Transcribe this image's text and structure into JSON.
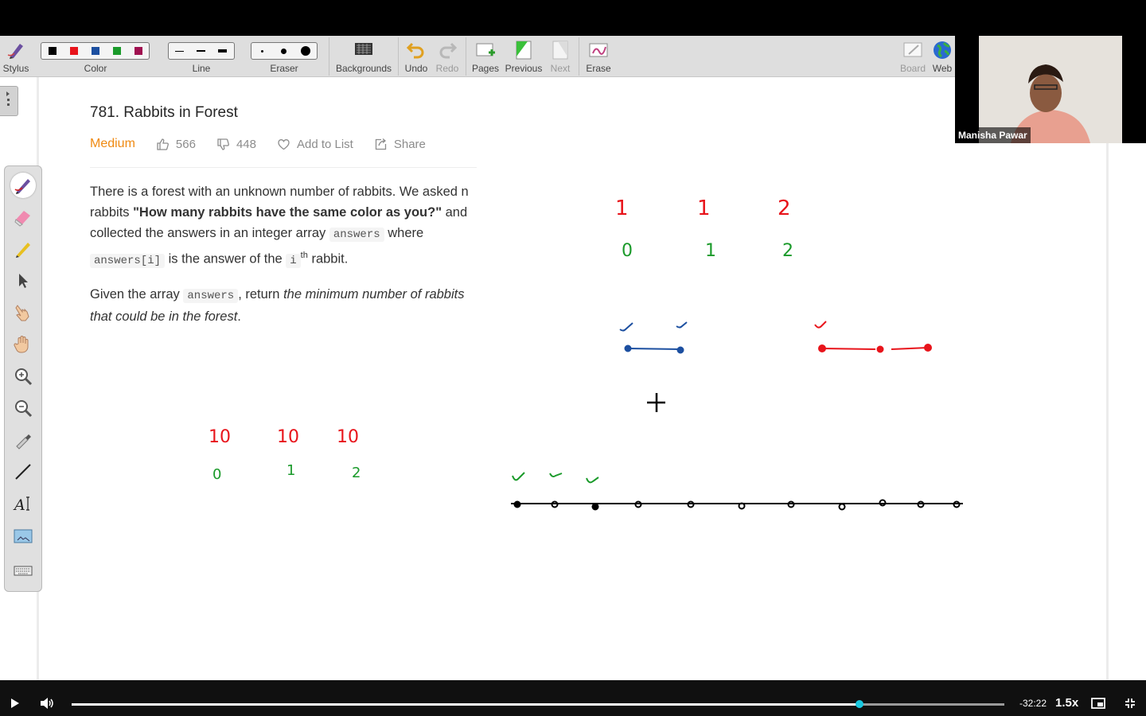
{
  "toolbar": {
    "stylus": "Stylus",
    "color": "Color",
    "line": "Line",
    "eraser": "Eraser",
    "backgrounds": "Backgrounds",
    "undo": "Undo",
    "redo": "Redo",
    "pages": "Pages",
    "previous": "Previous",
    "next": "Next",
    "erase": "Erase",
    "board": "Board",
    "web": "Web",
    "colors": [
      "#000000",
      "#e8141b",
      "#1c4fa0",
      "#1a9a2a",
      "#a01050"
    ]
  },
  "problem": {
    "title": "781. Rabbits in Forest",
    "difficulty": "Medium",
    "likes": "566",
    "dislikes": "448",
    "add_to_list": "Add to List",
    "share": "Share",
    "p1": {
      "t1": "There is a forest with an unknown number of rabbits. We asked n rabbits ",
      "bold": "\"How many rabbits have the same color as you?\"",
      "t2": " and collected the answers in an integer array ",
      "code1": "answers",
      "t3": " where ",
      "code2": "answers[i]",
      "t4": " is the answer of the ",
      "code3": "i",
      "sup": "th",
      "t5": " rabbit."
    },
    "p2": {
      "t1": "Given the array ",
      "code1": "answers",
      "t2": ", return ",
      "em": "the minimum number of rabbits that could be in the forest",
      "t3": "."
    }
  },
  "drawing": {
    "top_values": [
      "1",
      "1",
      "2"
    ],
    "top_indices": [
      "0",
      "1",
      "2"
    ],
    "bottom_values": [
      "10",
      "10",
      "10"
    ],
    "bottom_indices": [
      "0",
      "1",
      "2"
    ],
    "colors": {
      "red": "#e8141b",
      "green": "#1a9a2a",
      "blue": "#1c4fa0",
      "black": "#000000"
    }
  },
  "webcam": {
    "name": "Manisha Pawar"
  },
  "player": {
    "time_remaining": "-32:22",
    "speed": "1.5x",
    "progress": 0.845
  }
}
